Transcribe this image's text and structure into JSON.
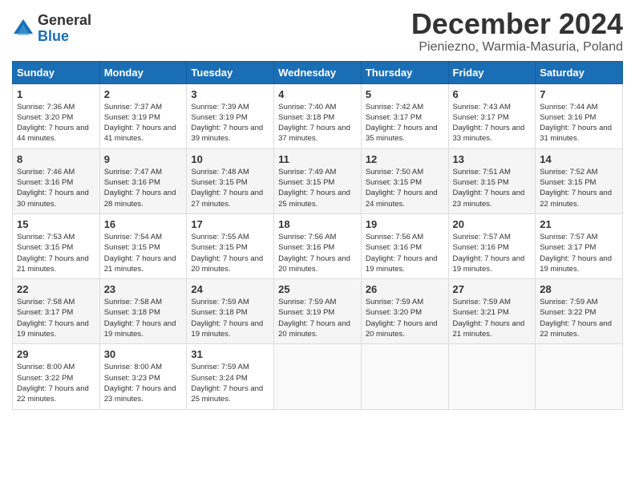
{
  "logo": {
    "general": "General",
    "blue": "Blue"
  },
  "title": "December 2024",
  "subtitle": "Pieniezno, Warmia-Masuria, Poland",
  "days_header": [
    "Sunday",
    "Monday",
    "Tuesday",
    "Wednesday",
    "Thursday",
    "Friday",
    "Saturday"
  ],
  "weeks": [
    [
      {
        "day": "1",
        "sunrise": "7:36 AM",
        "sunset": "3:20 PM",
        "daylight": "7 hours and 44 minutes."
      },
      {
        "day": "2",
        "sunrise": "7:37 AM",
        "sunset": "3:19 PM",
        "daylight": "7 hours and 41 minutes."
      },
      {
        "day": "3",
        "sunrise": "7:39 AM",
        "sunset": "3:19 PM",
        "daylight": "7 hours and 39 minutes."
      },
      {
        "day": "4",
        "sunrise": "7:40 AM",
        "sunset": "3:18 PM",
        "daylight": "7 hours and 37 minutes."
      },
      {
        "day": "5",
        "sunrise": "7:42 AM",
        "sunset": "3:17 PM",
        "daylight": "7 hours and 35 minutes."
      },
      {
        "day": "6",
        "sunrise": "7:43 AM",
        "sunset": "3:17 PM",
        "daylight": "7 hours and 33 minutes."
      },
      {
        "day": "7",
        "sunrise": "7:44 AM",
        "sunset": "3:16 PM",
        "daylight": "7 hours and 31 minutes."
      }
    ],
    [
      {
        "day": "8",
        "sunrise": "7:46 AM",
        "sunset": "3:16 PM",
        "daylight": "7 hours and 30 minutes."
      },
      {
        "day": "9",
        "sunrise": "7:47 AM",
        "sunset": "3:16 PM",
        "daylight": "7 hours and 28 minutes."
      },
      {
        "day": "10",
        "sunrise": "7:48 AM",
        "sunset": "3:15 PM",
        "daylight": "7 hours and 27 minutes."
      },
      {
        "day": "11",
        "sunrise": "7:49 AM",
        "sunset": "3:15 PM",
        "daylight": "7 hours and 25 minutes."
      },
      {
        "day": "12",
        "sunrise": "7:50 AM",
        "sunset": "3:15 PM",
        "daylight": "7 hours and 24 minutes."
      },
      {
        "day": "13",
        "sunrise": "7:51 AM",
        "sunset": "3:15 PM",
        "daylight": "7 hours and 23 minutes."
      },
      {
        "day": "14",
        "sunrise": "7:52 AM",
        "sunset": "3:15 PM",
        "daylight": "7 hours and 22 minutes."
      }
    ],
    [
      {
        "day": "15",
        "sunrise": "7:53 AM",
        "sunset": "3:15 PM",
        "daylight": "7 hours and 21 minutes."
      },
      {
        "day": "16",
        "sunrise": "7:54 AM",
        "sunset": "3:15 PM",
        "daylight": "7 hours and 21 minutes."
      },
      {
        "day": "17",
        "sunrise": "7:55 AM",
        "sunset": "3:15 PM",
        "daylight": "7 hours and 20 minutes."
      },
      {
        "day": "18",
        "sunrise": "7:56 AM",
        "sunset": "3:16 PM",
        "daylight": "7 hours and 20 minutes."
      },
      {
        "day": "19",
        "sunrise": "7:56 AM",
        "sunset": "3:16 PM",
        "daylight": "7 hours and 19 minutes."
      },
      {
        "day": "20",
        "sunrise": "7:57 AM",
        "sunset": "3:16 PM",
        "daylight": "7 hours and 19 minutes."
      },
      {
        "day": "21",
        "sunrise": "7:57 AM",
        "sunset": "3:17 PM",
        "daylight": "7 hours and 19 minutes."
      }
    ],
    [
      {
        "day": "22",
        "sunrise": "7:58 AM",
        "sunset": "3:17 PM",
        "daylight": "7 hours and 19 minutes."
      },
      {
        "day": "23",
        "sunrise": "7:58 AM",
        "sunset": "3:18 PM",
        "daylight": "7 hours and 19 minutes."
      },
      {
        "day": "24",
        "sunrise": "7:59 AM",
        "sunset": "3:18 PM",
        "daylight": "7 hours and 19 minutes."
      },
      {
        "day": "25",
        "sunrise": "7:59 AM",
        "sunset": "3:19 PM",
        "daylight": "7 hours and 20 minutes."
      },
      {
        "day": "26",
        "sunrise": "7:59 AM",
        "sunset": "3:20 PM",
        "daylight": "7 hours and 20 minutes."
      },
      {
        "day": "27",
        "sunrise": "7:59 AM",
        "sunset": "3:21 PM",
        "daylight": "7 hours and 21 minutes."
      },
      {
        "day": "28",
        "sunrise": "7:59 AM",
        "sunset": "3:22 PM",
        "daylight": "7 hours and 22 minutes."
      }
    ],
    [
      {
        "day": "29",
        "sunrise": "8:00 AM",
        "sunset": "3:22 PM",
        "daylight": "7 hours and 22 minutes."
      },
      {
        "day": "30",
        "sunrise": "8:00 AM",
        "sunset": "3:23 PM",
        "daylight": "7 hours and 23 minutes."
      },
      {
        "day": "31",
        "sunrise": "7:59 AM",
        "sunset": "3:24 PM",
        "daylight": "7 hours and 25 minutes."
      },
      null,
      null,
      null,
      null
    ]
  ]
}
